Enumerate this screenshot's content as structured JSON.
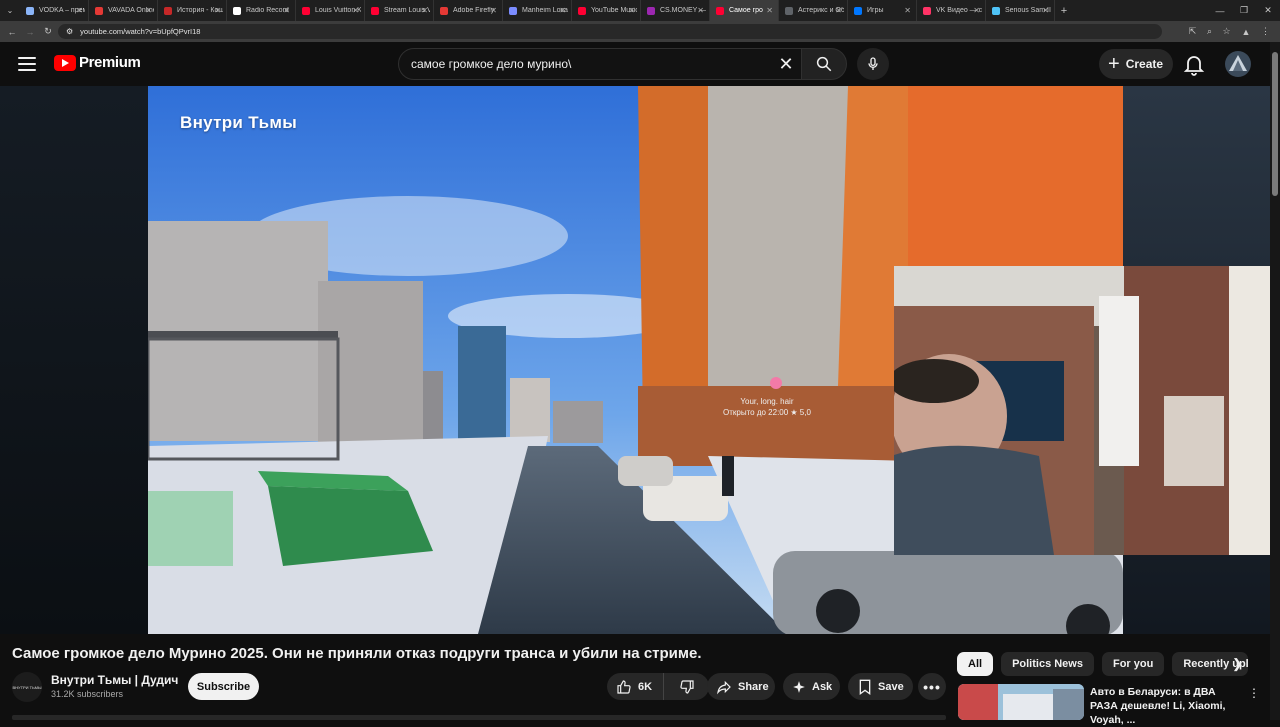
{
  "browser": {
    "tabs": [
      {
        "label": "VODKA – прем",
        "color": "#8ab4f8"
      },
      {
        "label": "VAVADA Online",
        "color": "#e53935"
      },
      {
        "label": "История - Кош",
        "color": "#c62828"
      },
      {
        "label": "Radio Record",
        "color": "#ffffff"
      },
      {
        "label": "Louis Vuitton K",
        "color": "#ff0033"
      },
      {
        "label": "Stream Louis V",
        "color": "#ff0033"
      },
      {
        "label": "Adobe Firefly",
        "color": "#e53935"
      },
      {
        "label": "Manheim Locat",
        "color": "#7b8cff"
      },
      {
        "label": "YouTube Music",
        "color": "#ff0033"
      },
      {
        "label": "CS.MONEY — ",
        "color": "#9c27b0"
      },
      {
        "label": "Самое гро",
        "color": "#ff0033"
      },
      {
        "label": "Астерикс и Об",
        "color": "#5f6368"
      },
      {
        "label": "Игры",
        "color": "#0077ff"
      },
      {
        "label": "VK Видео — с",
        "color": "#ff3366"
      },
      {
        "label": "Serious Sam II",
        "color": "#4fc3f7"
      }
    ],
    "active_tab_index": 10,
    "url": "youtube.com/watch?v=bUpfQPvrI18"
  },
  "header": {
    "logo_text": "Premium",
    "search_query": "самое громкое дело мурино\\",
    "create_label": "Create"
  },
  "video": {
    "overlay_title": "Внутри Тьмы",
    "map_pin_line1": "Your, long. hair",
    "map_pin_line2": "Открыто до 22:00 ★ 5,0",
    "title": "Самое громкое дело Мурино 2025. Они не приняли отказ подруги транса и убили на стриме."
  },
  "channel": {
    "name": "Внутри Тьмы | Дудич",
    "subscribers": "31.2K subscribers",
    "avatar_text": "ВНУТРИ ТЬМЫ",
    "subscribe_label": "Subscribe"
  },
  "actions": {
    "likes": "6K",
    "share_label": "Share",
    "ask_label": "Ask",
    "save_label": "Save"
  },
  "chips": [
    "All",
    "Politics News",
    "For you",
    "Recently uploa"
  ],
  "recommendation": {
    "title": "Авто в Беларуси: в ДВА РАЗА дешевле! Li, Xiaomi, Voyah, ..."
  },
  "colors": {
    "background": "#0f0f0f",
    "brand_red": "#ff0000",
    "pill": "#272727"
  }
}
